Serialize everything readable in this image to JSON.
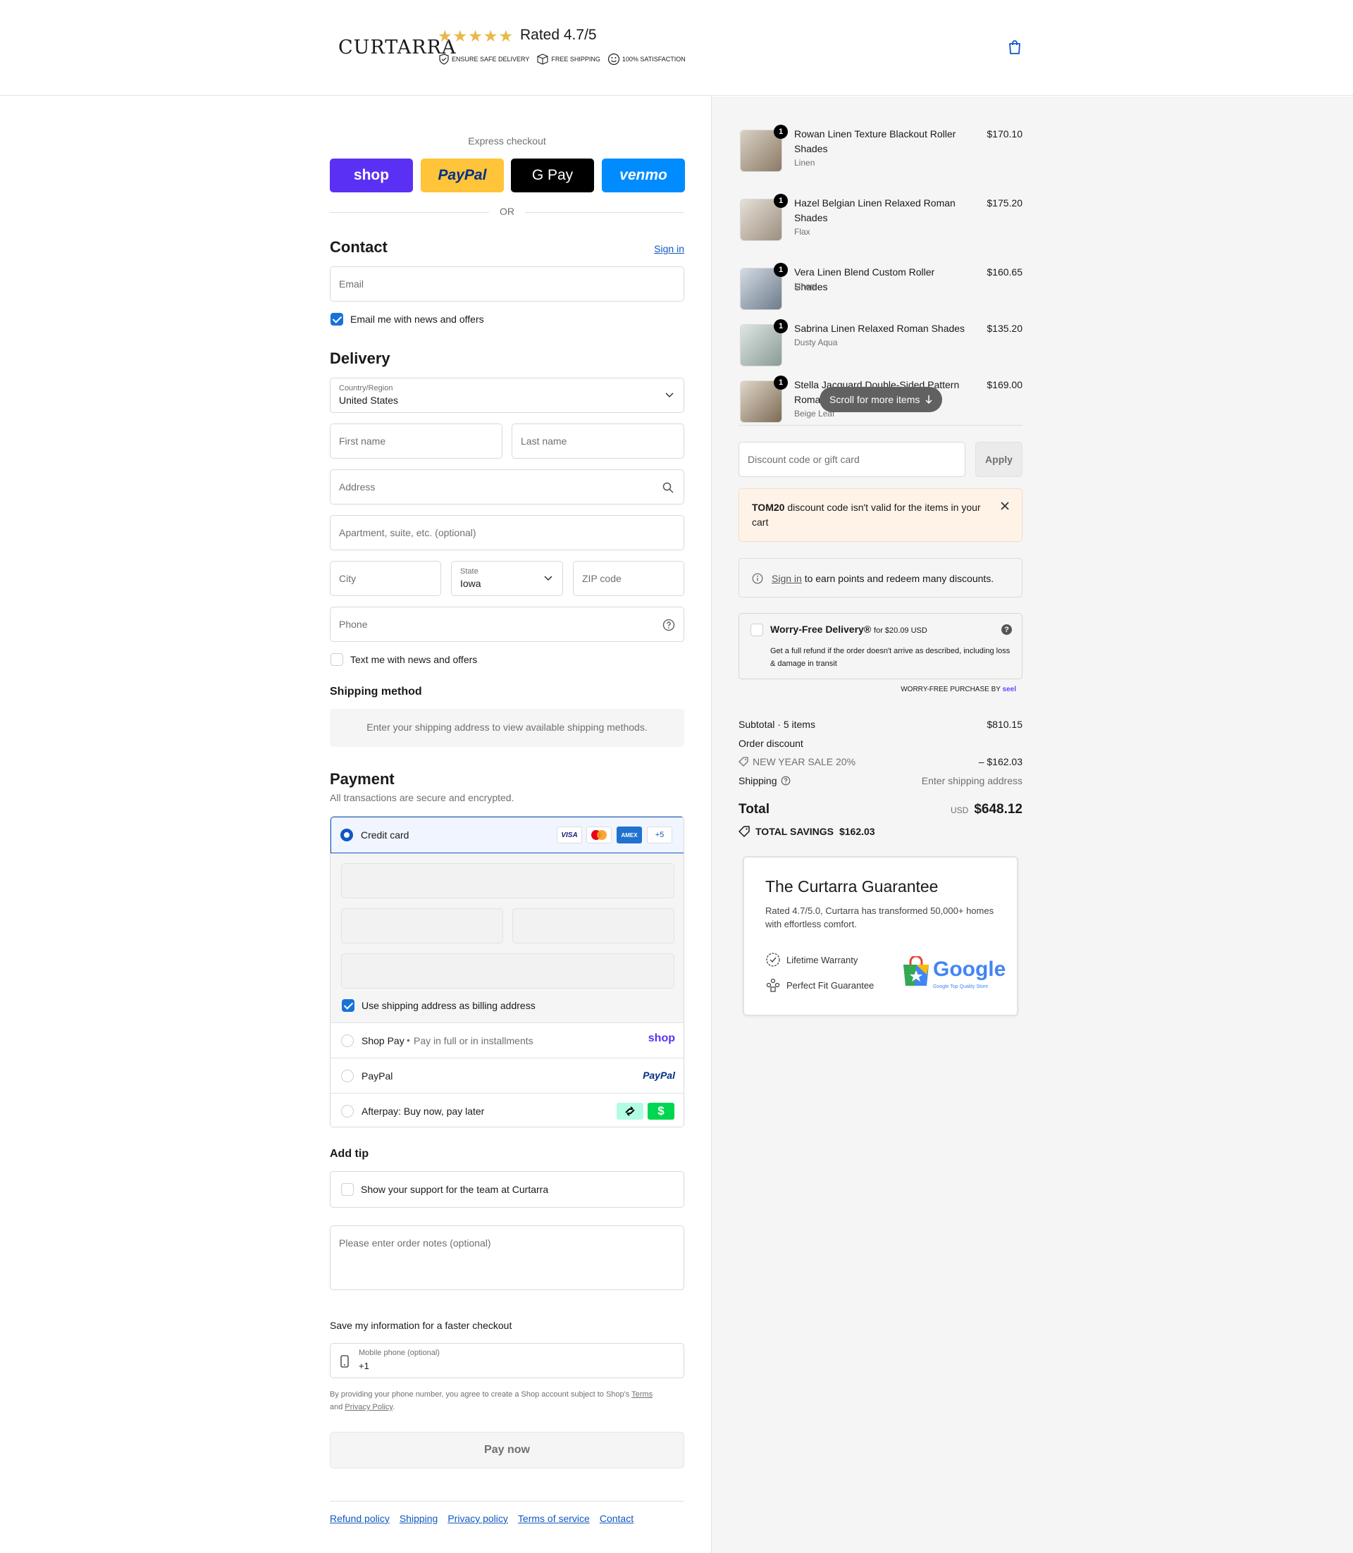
{
  "header": {
    "logo": "CURTARRA",
    "stars": "★★★★★",
    "rating": "Rated 4.7/5",
    "badges": [
      "ENSURE SAFE DELIVERY",
      "FREE SHIPPING",
      "100% SATISFACTION"
    ]
  },
  "express": {
    "label": "Express checkout",
    "buttons": [
      {
        "label": "shop",
        "bg": "#5a31f4",
        "fg": "#ffffff"
      },
      {
        "label": "PayPal",
        "bg": "#ffc439",
        "fg": "#003087"
      },
      {
        "label": "G Pay",
        "bg": "#000000",
        "fg": "#ffffff"
      },
      {
        "label": "venmo",
        "bg": "#008cff",
        "fg": "#ffffff"
      }
    ],
    "or": "OR"
  },
  "contact": {
    "title": "Contact",
    "sign_in": "Sign in",
    "email_placeholder": "Email",
    "news_label": "Email me with news and offers",
    "news_checked": true
  },
  "delivery": {
    "title": "Delivery",
    "country_label": "Country/Region",
    "country_value": "United States",
    "first_name": "First name",
    "last_name": "Last name",
    "address": "Address",
    "apartment": "Apartment, suite, etc. (optional)",
    "city": "City",
    "state_label": "State",
    "state_value": "Iowa",
    "zip": "ZIP code",
    "phone": "Phone",
    "text_label": "Text me with news and offers"
  },
  "shipping_method": {
    "title": "Shipping method",
    "message": "Enter your shipping address to view available shipping methods."
  },
  "payment": {
    "title": "Payment",
    "subtitle": "All transactions are secure and encrypted.",
    "credit_card": "Credit card",
    "card_brands": [
      "VISA",
      "MC",
      "AMEX",
      "+5"
    ],
    "billing_label": "Use shipping address as billing address",
    "shop_pay": "Shop Pay",
    "shop_pay_sub": "Pay in full or in installments",
    "shop_logo": "shop",
    "paypal": "PayPal",
    "paypal_logo": "PayPal",
    "afterpay": "Afterpay: Buy now, pay later"
  },
  "tip": {
    "title": "Add tip",
    "label": "Show your support for the team at Curtarra"
  },
  "notes_placeholder": "Please enter order notes (optional)",
  "save_info": {
    "title": "Save my information for a faster checkout",
    "phone_label": "Mobile phone (optional)",
    "phone_value": "+1",
    "legal_prefix": "By providing your phone number, you agree to create a Shop account subject to Shop's",
    "terms": "Terms",
    "and": "and",
    "privacy": "Privacy Policy",
    "period": "."
  },
  "pay_now": "Pay now",
  "footer": [
    "Refund policy",
    "Shipping",
    "Privacy policy",
    "Terms of service",
    "Contact"
  ],
  "cart": {
    "items": [
      {
        "qty": "1",
        "name": "Rowan Linen Texture Blackout Roller Shades",
        "variant": "Linen",
        "price": "$170.10"
      },
      {
        "qty": "1",
        "name": "Hazel Belgian Linen Relaxed Roman Shades",
        "variant": "Flax",
        "price": "$175.20"
      },
      {
        "qty": "1",
        "name": "Vera Linen Blend Custom Roller Shades",
        "variant": "Linen",
        "price": "$160.65"
      },
      {
        "qty": "1",
        "name": "Sabrina Linen Relaxed Roman Shades",
        "variant": "Dusty Aqua",
        "price": "$135.20"
      },
      {
        "qty": "1",
        "name": "Stella Jacquard Double-Sided Pattern Roman Shades",
        "variant": "Beige Leaf",
        "price": "$169.00"
      }
    ],
    "scroll_hint": "Scroll for more items",
    "discount_placeholder": "Discount code or gift card",
    "apply": "Apply",
    "error_code": "TOM20",
    "error_text": " discount code isn't valid for the items in your cart",
    "signin_link": "Sign in",
    "signin_text": " to earn points and redeem many discounts.",
    "worry_title": "Worry-Free Delivery®",
    "worry_price": "for $20.09 USD",
    "worry_desc": "Get a full refund if the order doesn't arrive as described, including loss & damage in transit",
    "seel_prefix": "WORRY-FREE PURCHASE BY",
    "seel_brand": "seel",
    "subtotal_label": "Subtotal · 5 items",
    "subtotal_value": "$810.15",
    "order_discount": "Order discount",
    "discount_name": "NEW YEAR SALE 20%",
    "discount_value": "– $162.03",
    "shipping_label": "Shipping",
    "shipping_value": "Enter shipping address",
    "total_label": "Total",
    "currency": "USD",
    "total_value": "$648.12",
    "savings_label": "TOTAL SAVINGS",
    "savings_value": "$162.03"
  },
  "guarantee": {
    "title": "The Curtarra Guarantee",
    "desc": "Rated 4.7/5.0, Curtarra has transformed 50,000+ homes with effortless comfort.",
    "features": [
      "Lifetime Warranty",
      "Perfect Fit Guarantee"
    ],
    "google_word": "Google",
    "google_sub": "Google Top Quality Store"
  },
  "colors": {
    "accent": "#1058c2",
    "error_bg": "#fff3e8",
    "sidebar_bg": "#f5f5f5"
  }
}
